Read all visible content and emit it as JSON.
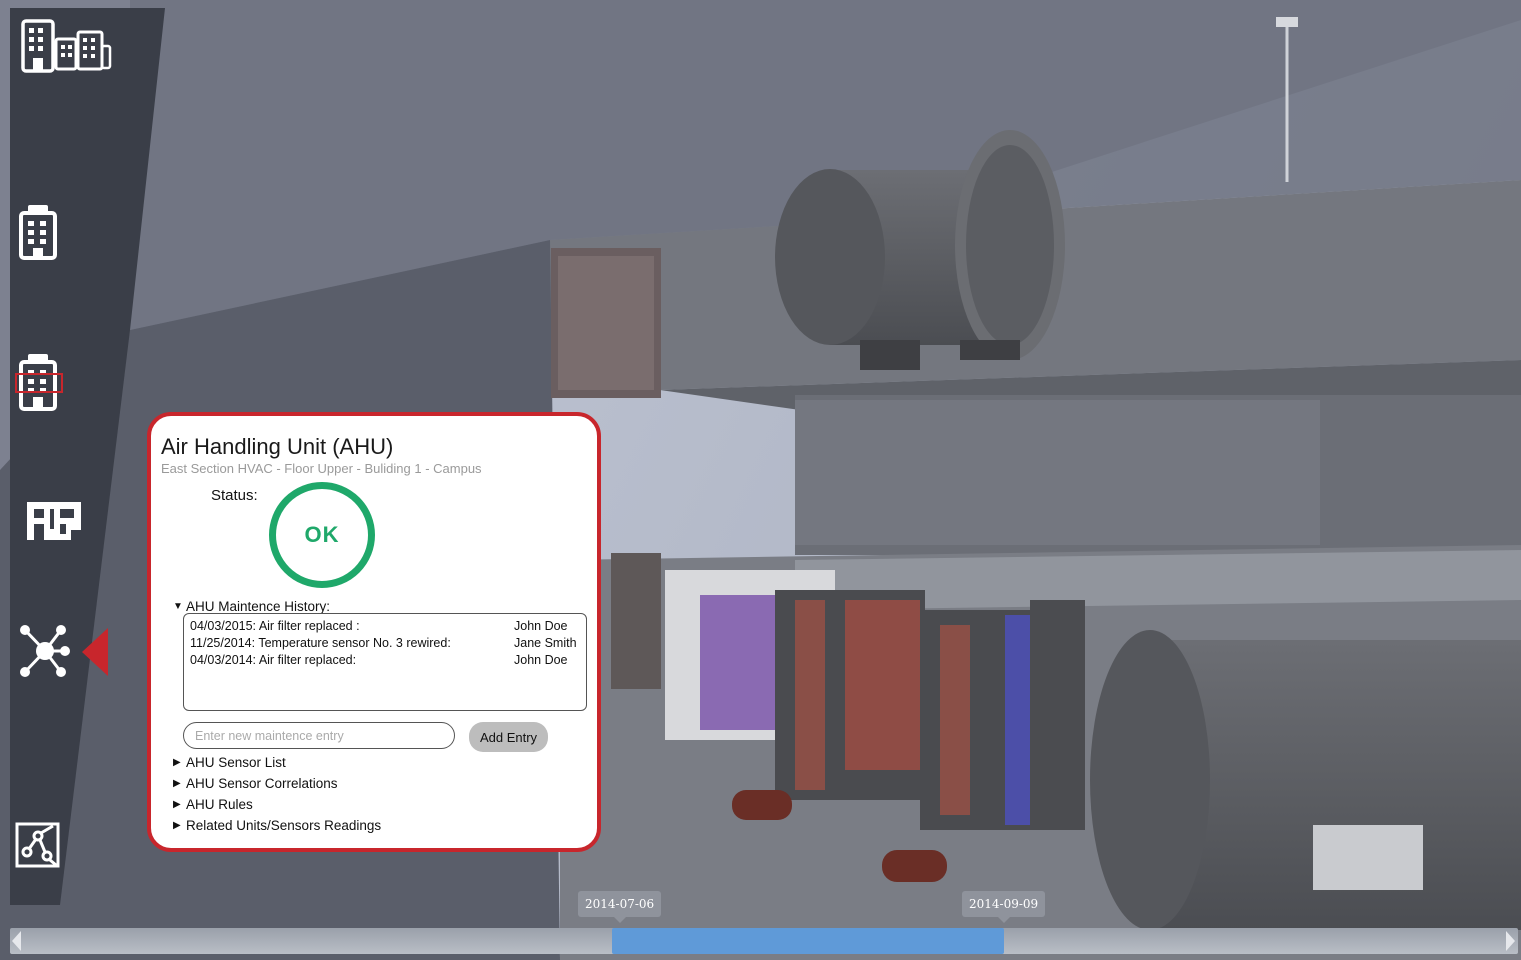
{
  "colors": {
    "accent_red": "#c8262c",
    "status_ok_green": "#1fa86a",
    "timeline_range_blue": "#5f9ad8",
    "sidebar_dark": "#3a3e48"
  },
  "sidebar": {
    "items": [
      {
        "name": "campus-view-button",
        "icon": "multi-building-icon"
      },
      {
        "name": "building-view-button",
        "icon": "building-icon"
      },
      {
        "name": "floor-view-button",
        "icon": "building-floor-highlight-icon",
        "selected_highlight": true
      },
      {
        "name": "floorplan-view-button",
        "icon": "floorplan-icon"
      },
      {
        "name": "network-view-button",
        "icon": "network-hub-icon",
        "active": true
      },
      {
        "name": "connections-view-button",
        "icon": "node-connections-icon"
      }
    ]
  },
  "panel": {
    "title": "Air Handling Unit (AHU)",
    "subtitle": "East Section HVAC - Floor Upper - Buliding 1 - Campus",
    "status_label": "Status:",
    "status_value": "OK",
    "history": {
      "label": "AHU Maintence History:",
      "expanded": true,
      "entries": [
        {
          "text": "04/03/2015: Air filter replaced :",
          "author": "John Doe"
        },
        {
          "text": "11/25/2014: Temperature sensor No. 3 rewired:",
          "author": "Jane Smith"
        },
        {
          "text": "04/03/2014: Air filter replaced:",
          "author": "John Doe"
        }
      ]
    },
    "new_entry": {
      "placeholder": "Enter new maintence entry",
      "value": ""
    },
    "add_button": "Add Entry",
    "sections": [
      {
        "label": "AHU Sensor List",
        "expanded": false
      },
      {
        "label": "AHU Sensor Correlations",
        "expanded": false
      },
      {
        "label": "AHU Rules",
        "expanded": false
      },
      {
        "label": "Related Units/Sensors Readings",
        "expanded": false
      }
    ]
  },
  "timeline": {
    "start_label": "2014-07-06",
    "end_label": "2014-09-09"
  }
}
